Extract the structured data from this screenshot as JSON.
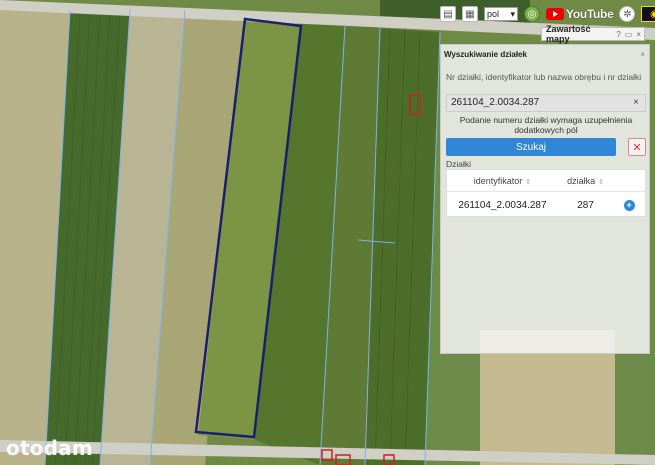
{
  "map": {
    "colors": {
      "field_dark": "#4f6b2f",
      "field_mid": "#6f8a45",
      "field_light": "#a9a675",
      "field_pale": "#c4b98f",
      "road": "#cfcfc6",
      "parcel_outline": "#1a1f6e",
      "cadastral_lines": "#7fb3e8",
      "building_outline": "#d21f1f"
    }
  },
  "toolbar": {
    "print_icon": "printer-icon",
    "table_icon": "table-icon",
    "language_value": "pol",
    "youtube_label": "YouTube",
    "help_icon": "lifebuoy-icon",
    "eye_icon": "eye-icon"
  },
  "layers_tab": {
    "label": "Zawartość mapy",
    "help": "?",
    "minimize": "▭",
    "close": "×"
  },
  "panel": {
    "title": "Wyszukiwanie działek",
    "close": "×",
    "hint": "Nr działki, identyfikator lub nazwa obrębu i nr działki",
    "search_value": "261104_2.0034.287",
    "clear": "×",
    "message": "Podanie numeru działki wymaga uzupełnienia dodatkowych pól",
    "search_button": "Szukaj",
    "cancel_button": "✕",
    "section_label": "Działki",
    "columns": {
      "identifier": "identyfikator",
      "parcel": "działka",
      "sort": "⇕"
    },
    "rows": [
      {
        "identifier": "261104_2.0034.287",
        "parcel": "287",
        "add": "+"
      }
    ]
  },
  "watermark": "otodam"
}
